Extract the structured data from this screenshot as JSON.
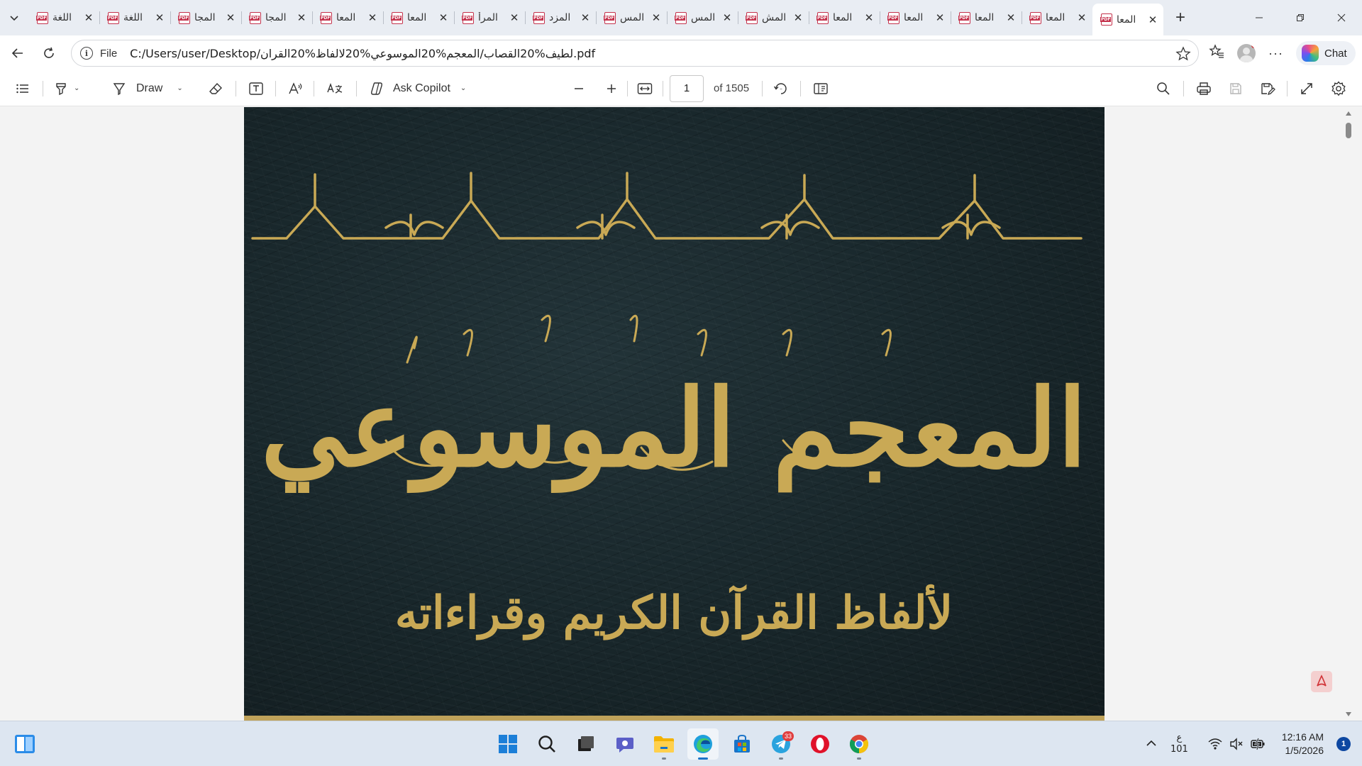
{
  "browser": {
    "tabs": [
      {
        "title": "اللغة",
        "active": false
      },
      {
        "title": "اللغة",
        "active": false
      },
      {
        "title": "المجا",
        "active": false
      },
      {
        "title": "المجا",
        "active": false
      },
      {
        "title": "المعا",
        "active": false
      },
      {
        "title": "المعا",
        "active": false
      },
      {
        "title": "المرأ",
        "active": false
      },
      {
        "title": "المزد",
        "active": false
      },
      {
        "title": "المس",
        "active": false
      },
      {
        "title": "المس",
        "active": false
      },
      {
        "title": "المش",
        "active": false
      },
      {
        "title": "المعا",
        "active": false
      },
      {
        "title": "المعا",
        "active": false
      },
      {
        "title": "المعا",
        "active": false
      },
      {
        "title": "المعا",
        "active": false
      },
      {
        "title": "المعا",
        "active": true
      }
    ],
    "address": {
      "scheme": "File",
      "url": "C:/Users/user/Desktop/لطيف%20القصاب/المعجم%20الموسوعي%20لالفاظ%20القران.pdf"
    },
    "chat_label": "Chat"
  },
  "pdf_toolbar": {
    "draw_label": "Draw",
    "ask_copilot_label": "Ask Copilot",
    "page_current": "1",
    "page_total_label": "of 1505"
  },
  "document": {
    "cover_title": "المعجم الموسوعي",
    "cover_subtitle": "لألفاظ القرآن الكريم وقراءاته"
  },
  "taskbar": {
    "telegram_badge": "33",
    "lang_top": "ع",
    "lang_bottom": "101",
    "time": "12:16 AM",
    "date": "1/5/2026",
    "notification_count": "1"
  },
  "colors": {
    "accent": "#1a73c8",
    "pdf_red": "#c4314b",
    "gold": "#c9a955",
    "leather": "#1a282c"
  }
}
